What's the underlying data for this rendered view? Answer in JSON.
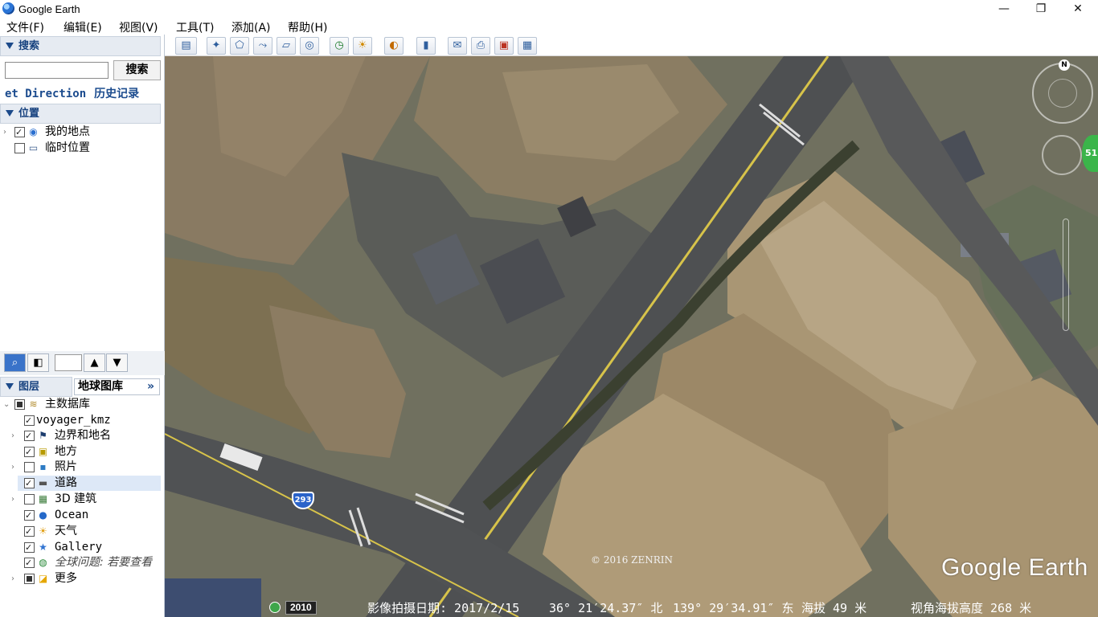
{
  "window": {
    "title": "Google Earth",
    "icon": "google-earth-icon"
  },
  "menu": [
    "文件(F)",
    "编辑(E)",
    "视图(V)",
    "工具(T)",
    "添加(A)",
    "帮助(H)"
  ],
  "search": {
    "header": "搜索",
    "input_value": "",
    "button_label": "搜索",
    "tab_get_directions": "et Direction",
    "tab_history": "历史记录"
  },
  "places": {
    "header": "位置",
    "items": [
      {
        "label": "我的地点",
        "checked": true,
        "icon": "globe-icon"
      },
      {
        "label": "临时位置",
        "checked": false,
        "icon": "folder-icon"
      }
    ]
  },
  "layers": {
    "header": "图层",
    "gallery_button": "地球图库",
    "gallery_chevron": "»",
    "items": [
      {
        "label": "主数据库",
        "icon": "database-icon",
        "state": "partial"
      },
      {
        "label": "voyager_kmz",
        "icon": "",
        "state": "checked"
      },
      {
        "label": "边界和地名",
        "icon": "flag-icon",
        "state": "checked"
      },
      {
        "label": "地方",
        "icon": "place-icon",
        "state": "checked"
      },
      {
        "label": "照片",
        "icon": "photo-icon",
        "state": "unchecked"
      },
      {
        "label": "道路",
        "icon": "road-icon",
        "state": "checked"
      },
      {
        "label": "3D 建筑",
        "icon": "building-icon",
        "state": "unchecked"
      },
      {
        "label": "Ocean",
        "icon": "ocean-icon",
        "state": "checked"
      },
      {
        "label": "天气",
        "icon": "weather-icon",
        "state": "checked"
      },
      {
        "label": "Gallery",
        "icon": "star-icon",
        "state": "checked"
      },
      {
        "label": "全球问题: 若要查看",
        "icon": "globe-icon",
        "state": "checked"
      },
      {
        "label": "更多",
        "icon": "more-icon",
        "state": "partial"
      }
    ]
  },
  "toolbar": {
    "buttons": [
      "sidebar-toggle-icon",
      "placemark-icon",
      "polygon-icon",
      "path-icon",
      "image-overlay-icon",
      "record-tour-icon",
      "historical-imagery-icon",
      "sunlight-icon",
      "planet-icon",
      "ruler-icon",
      "email-icon",
      "print-icon",
      "save-image-icon",
      "view-in-maps-icon"
    ]
  },
  "map": {
    "route_number": "293",
    "copyright": "© 2016 ZENRIN",
    "logo": "Google Earth",
    "compass_north": "N",
    "badge": "51"
  },
  "status": {
    "year": "2010",
    "imagery_date": "影像拍摄日期: 2017/2/15",
    "latitude": "36° 21′24.37″ 北",
    "longitude": "139° 29′34.91″ 东",
    "elevation": "海拔   49 米",
    "eye_alt": "视角海拔高度   268 米"
  },
  "colors": {
    "panel_header_bg": "#e6ebf2",
    "panel_header_text": "#17427f",
    "selected_row": "#dde8f7"
  }
}
